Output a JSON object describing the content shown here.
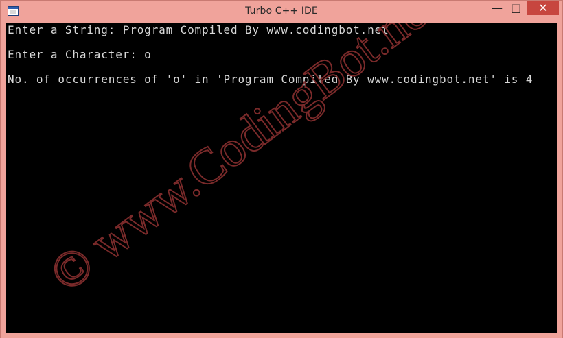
{
  "window": {
    "title": "Turbo C++ IDE",
    "controls": {
      "minimize_icon": "minimize-icon",
      "maximize_icon": "maximize-icon",
      "close_icon": "close-icon",
      "minimize_glyph": "—",
      "maximize_glyph": "□",
      "close_glyph": "✕"
    },
    "accent_color": "#f0a39b",
    "close_color": "#c7463f"
  },
  "console": {
    "lines": [
      "Enter a String: Program Compiled By www.codingbot.net",
      "Enter a Character: o",
      "No. of occurrences of 'o' in 'Program Compiled By www.codingbot.net' is 4"
    ],
    "background": "#000000",
    "text_color": "#d8d8d8"
  },
  "watermark": {
    "text": "© www.CodingBot.net",
    "color": "#7a2a2a"
  }
}
